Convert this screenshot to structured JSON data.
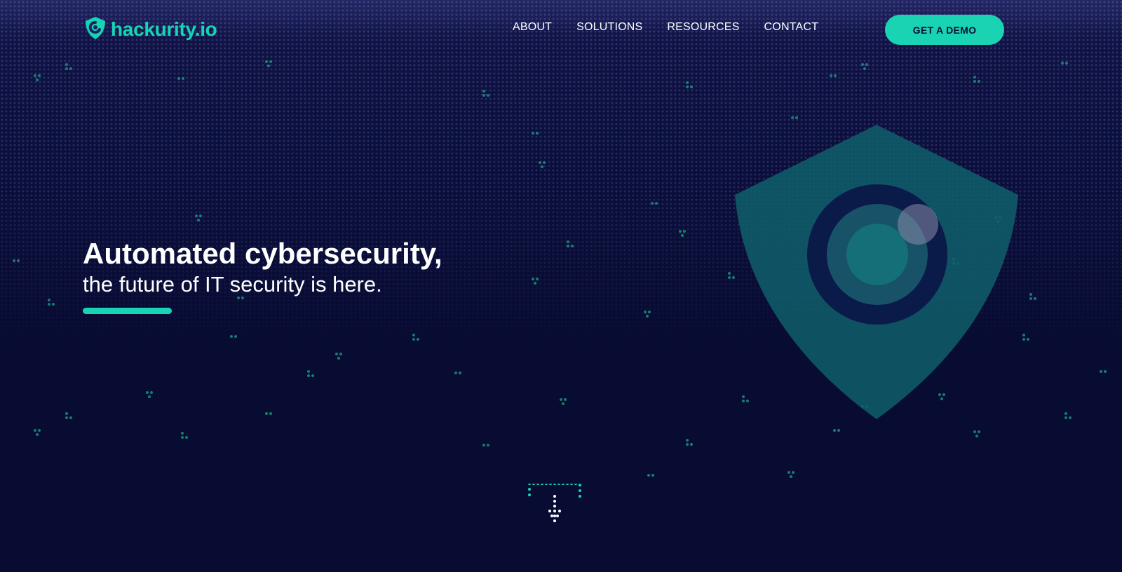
{
  "header": {
    "logo_text": "hackurity.io",
    "nav": [
      "ABOUT",
      "SOLUTIONS",
      "RESOURCES",
      "CONTACT"
    ],
    "cta_label": "GET A DEMO"
  },
  "hero": {
    "headline": "Automated cybersecurity,",
    "subheadline": "the future of IT security is here."
  },
  "colors": {
    "accent": "#17d4b4",
    "background": "#080c33",
    "shield": "#0f5f6b"
  },
  "icons": {
    "logo": "shield-logo-icon",
    "hero_art": "shield-lock-illustration",
    "scroll": "scroll-down-arrow-icon"
  }
}
